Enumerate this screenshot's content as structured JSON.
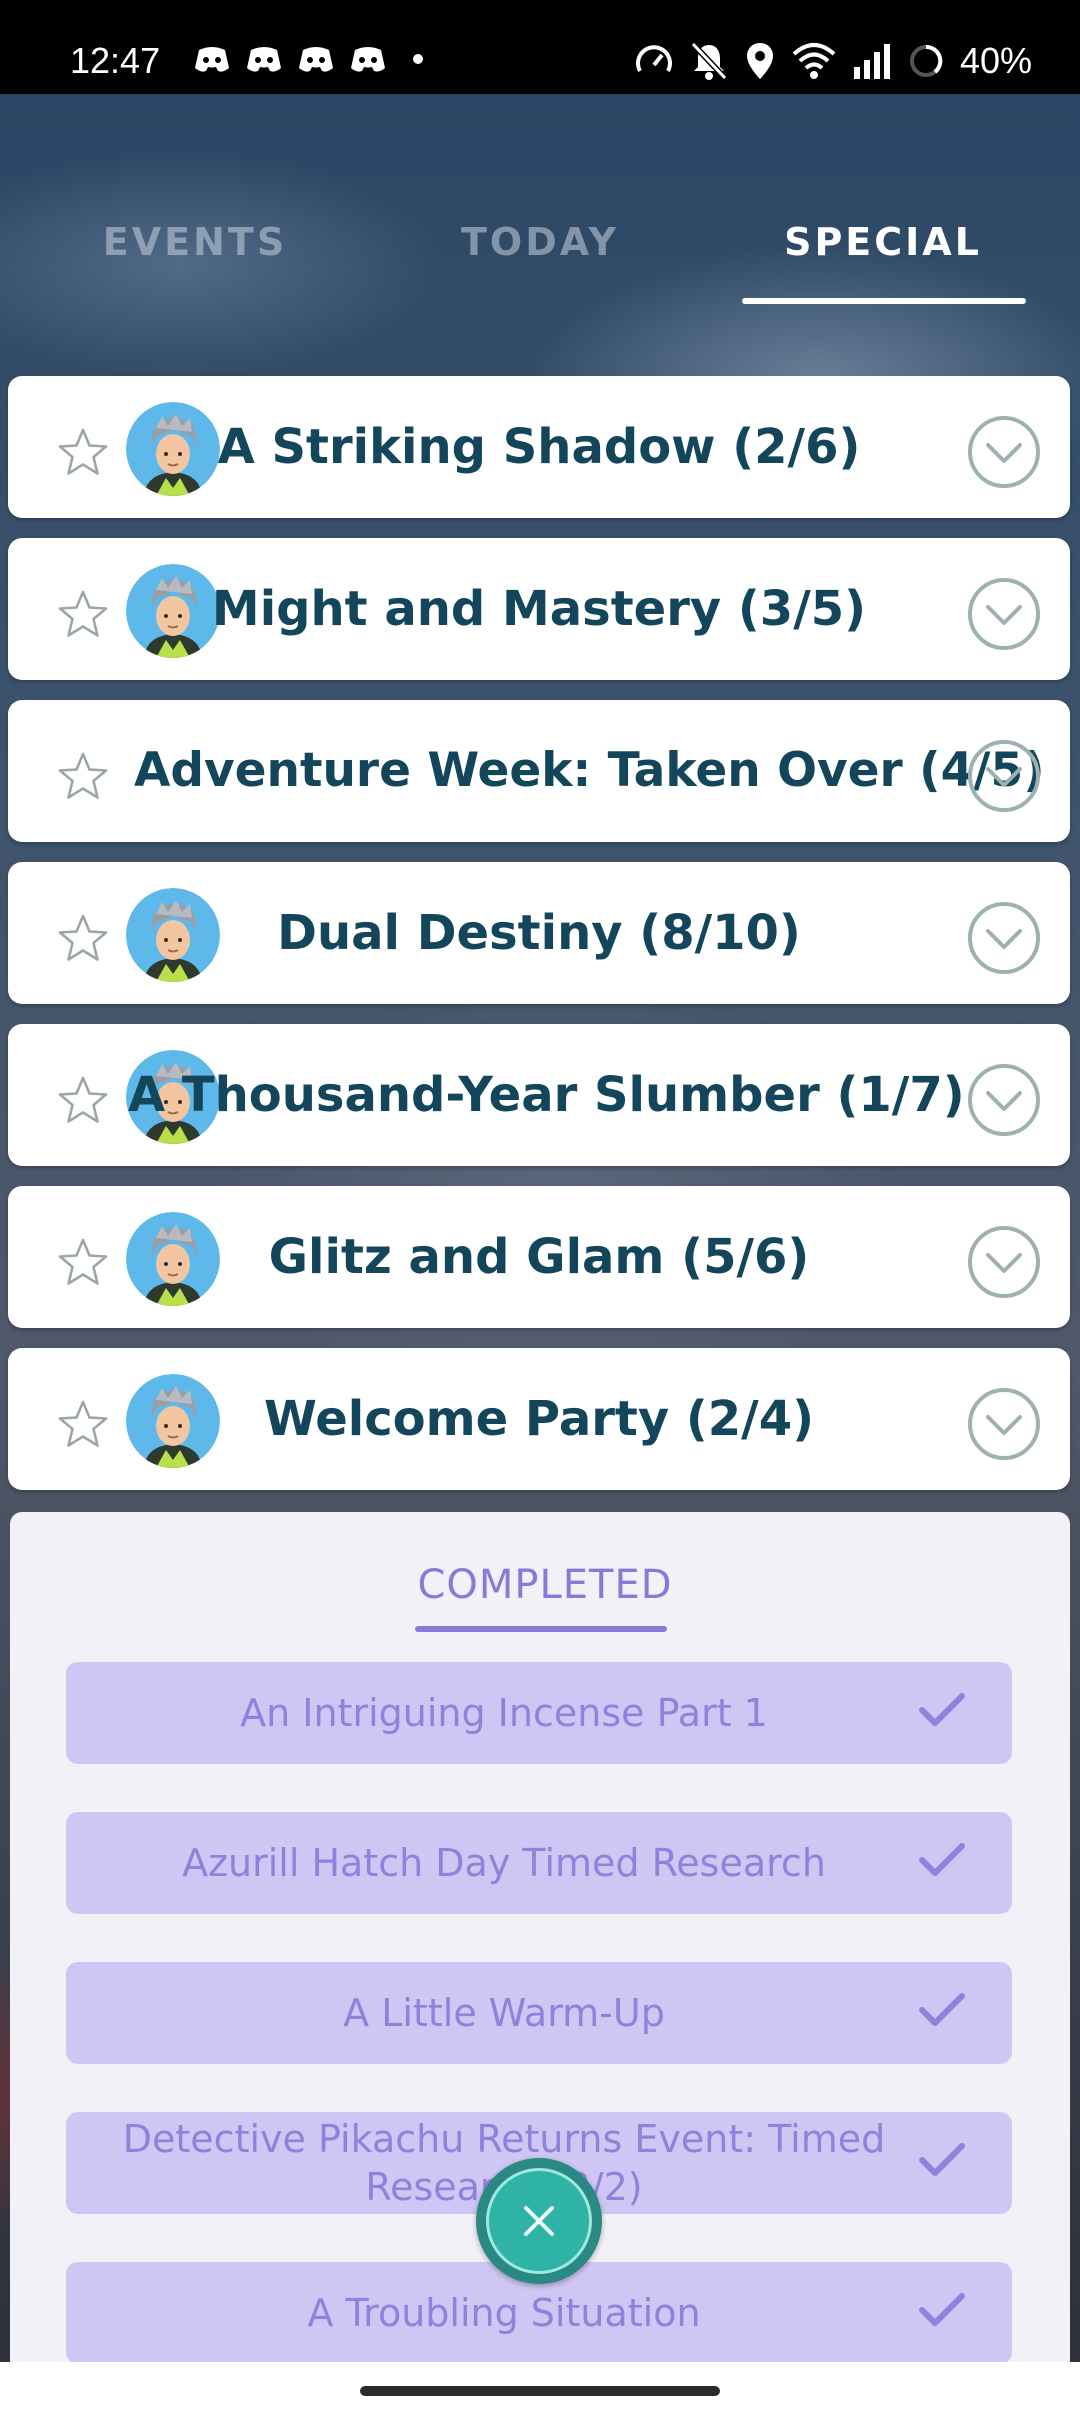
{
  "status_bar": {
    "time": "12:47",
    "battery": "40%",
    "notification_icons": [
      "discord-icon",
      "discord-icon",
      "discord-icon",
      "discord-icon"
    ],
    "system_icons": [
      "speed-icon",
      "mute-icon",
      "location-icon",
      "wifi-icon",
      "signal-icon",
      "battery-icon"
    ]
  },
  "tabs": [
    {
      "label": "EVENTS",
      "active": false
    },
    {
      "label": "TODAY",
      "active": false
    },
    {
      "label": "SPECIAL",
      "active": true
    }
  ],
  "quests": [
    {
      "title": "A Striking Shadow (2/6)",
      "has_avatar": true
    },
    {
      "title": "Might and Mastery (3/5)",
      "has_avatar": true
    },
    {
      "title": "Adventure Week: Taken Over (4/5)",
      "has_avatar": false
    },
    {
      "title": "Dual Destiny (8/10)",
      "has_avatar": true
    },
    {
      "title": "A Thousand-Year Slumber (1/7)",
      "has_avatar": true
    },
    {
      "title": "Glitz and Glam (5/6)",
      "has_avatar": true
    },
    {
      "title": "Welcome Party (2/4)",
      "has_avatar": true
    }
  ],
  "completed": {
    "tab_label": "COMPLETED",
    "items": [
      {
        "label": "An Intriguing Incense Part 1"
      },
      {
        "label": "Azurill Hatch Day Timed Research"
      },
      {
        "label": "A Little Warm-Up"
      },
      {
        "label": "Detective Pikachu Returns Event: Timed Research (2/2)"
      },
      {
        "label": "A Troubling Situation"
      }
    ]
  },
  "colors": {
    "quest_title": "#13465a",
    "completed_accent": "#8a7ad8",
    "completed_item_bg": "#cfc6f3",
    "close_button": "#2fb3a6"
  }
}
